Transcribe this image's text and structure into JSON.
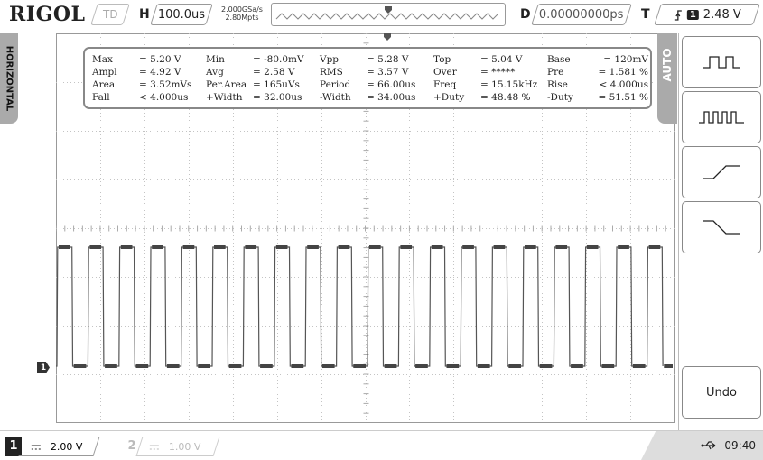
{
  "brand": "RIGOL",
  "status": {
    "td": "TD",
    "h_label": "H",
    "timebase": "100.0us",
    "sample_rate": "2.000GSa/s",
    "memory_depth": "2.80Mpts",
    "d_label": "D",
    "delay": "0.00000000ps",
    "t_label": "T",
    "trigger_channel": "1",
    "trigger_level": "2.48 V"
  },
  "side_tab_left": "HORIZONTAL",
  "side_tab_right": "AUTO",
  "measurements": [
    [
      [
        "Max",
        "= 5.20 V"
      ],
      [
        "Min",
        "= -80.0mV"
      ],
      [
        "Vpp",
        "= 5.28 V"
      ],
      [
        "Top",
        "= 5.04 V"
      ],
      [
        "Base",
        "= 120mV"
      ]
    ],
    [
      [
        "Ampl",
        "= 4.92 V"
      ],
      [
        "Avg",
        "= 2.58 V"
      ],
      [
        "RMS",
        "= 3.57 V"
      ],
      [
        "Over",
        "= *****"
      ],
      [
        "Pre",
        "= 1.581 %"
      ]
    ],
    [
      [
        "Area",
        "= 3.52mVs"
      ],
      [
        "Per.Area",
        "= 165uVs"
      ],
      [
        "Period",
        "= 66.00us"
      ],
      [
        "Freq",
        "= 15.15kHz"
      ],
      [
        "Rise",
        "< 4.000us"
      ]
    ],
    [
      [
        "Fall",
        "< 4.000us"
      ],
      [
        "+Width",
        "= 32.00us"
      ],
      [
        "-Width",
        "= 34.00us"
      ],
      [
        "+Duty",
        "= 48.48 %"
      ],
      [
        "-Duty",
        "= 51.51 %"
      ]
    ]
  ],
  "right_menu": {
    "undo": "Undo"
  },
  "channels": [
    {
      "num": "1",
      "scale": "2.00 V",
      "active": true
    },
    {
      "num": "2",
      "scale": "1.00 V",
      "active": false
    }
  ],
  "time": "09:40",
  "colors": {
    "trace": "#555555",
    "grid": "#bbbbbb",
    "accent": "#333333"
  }
}
